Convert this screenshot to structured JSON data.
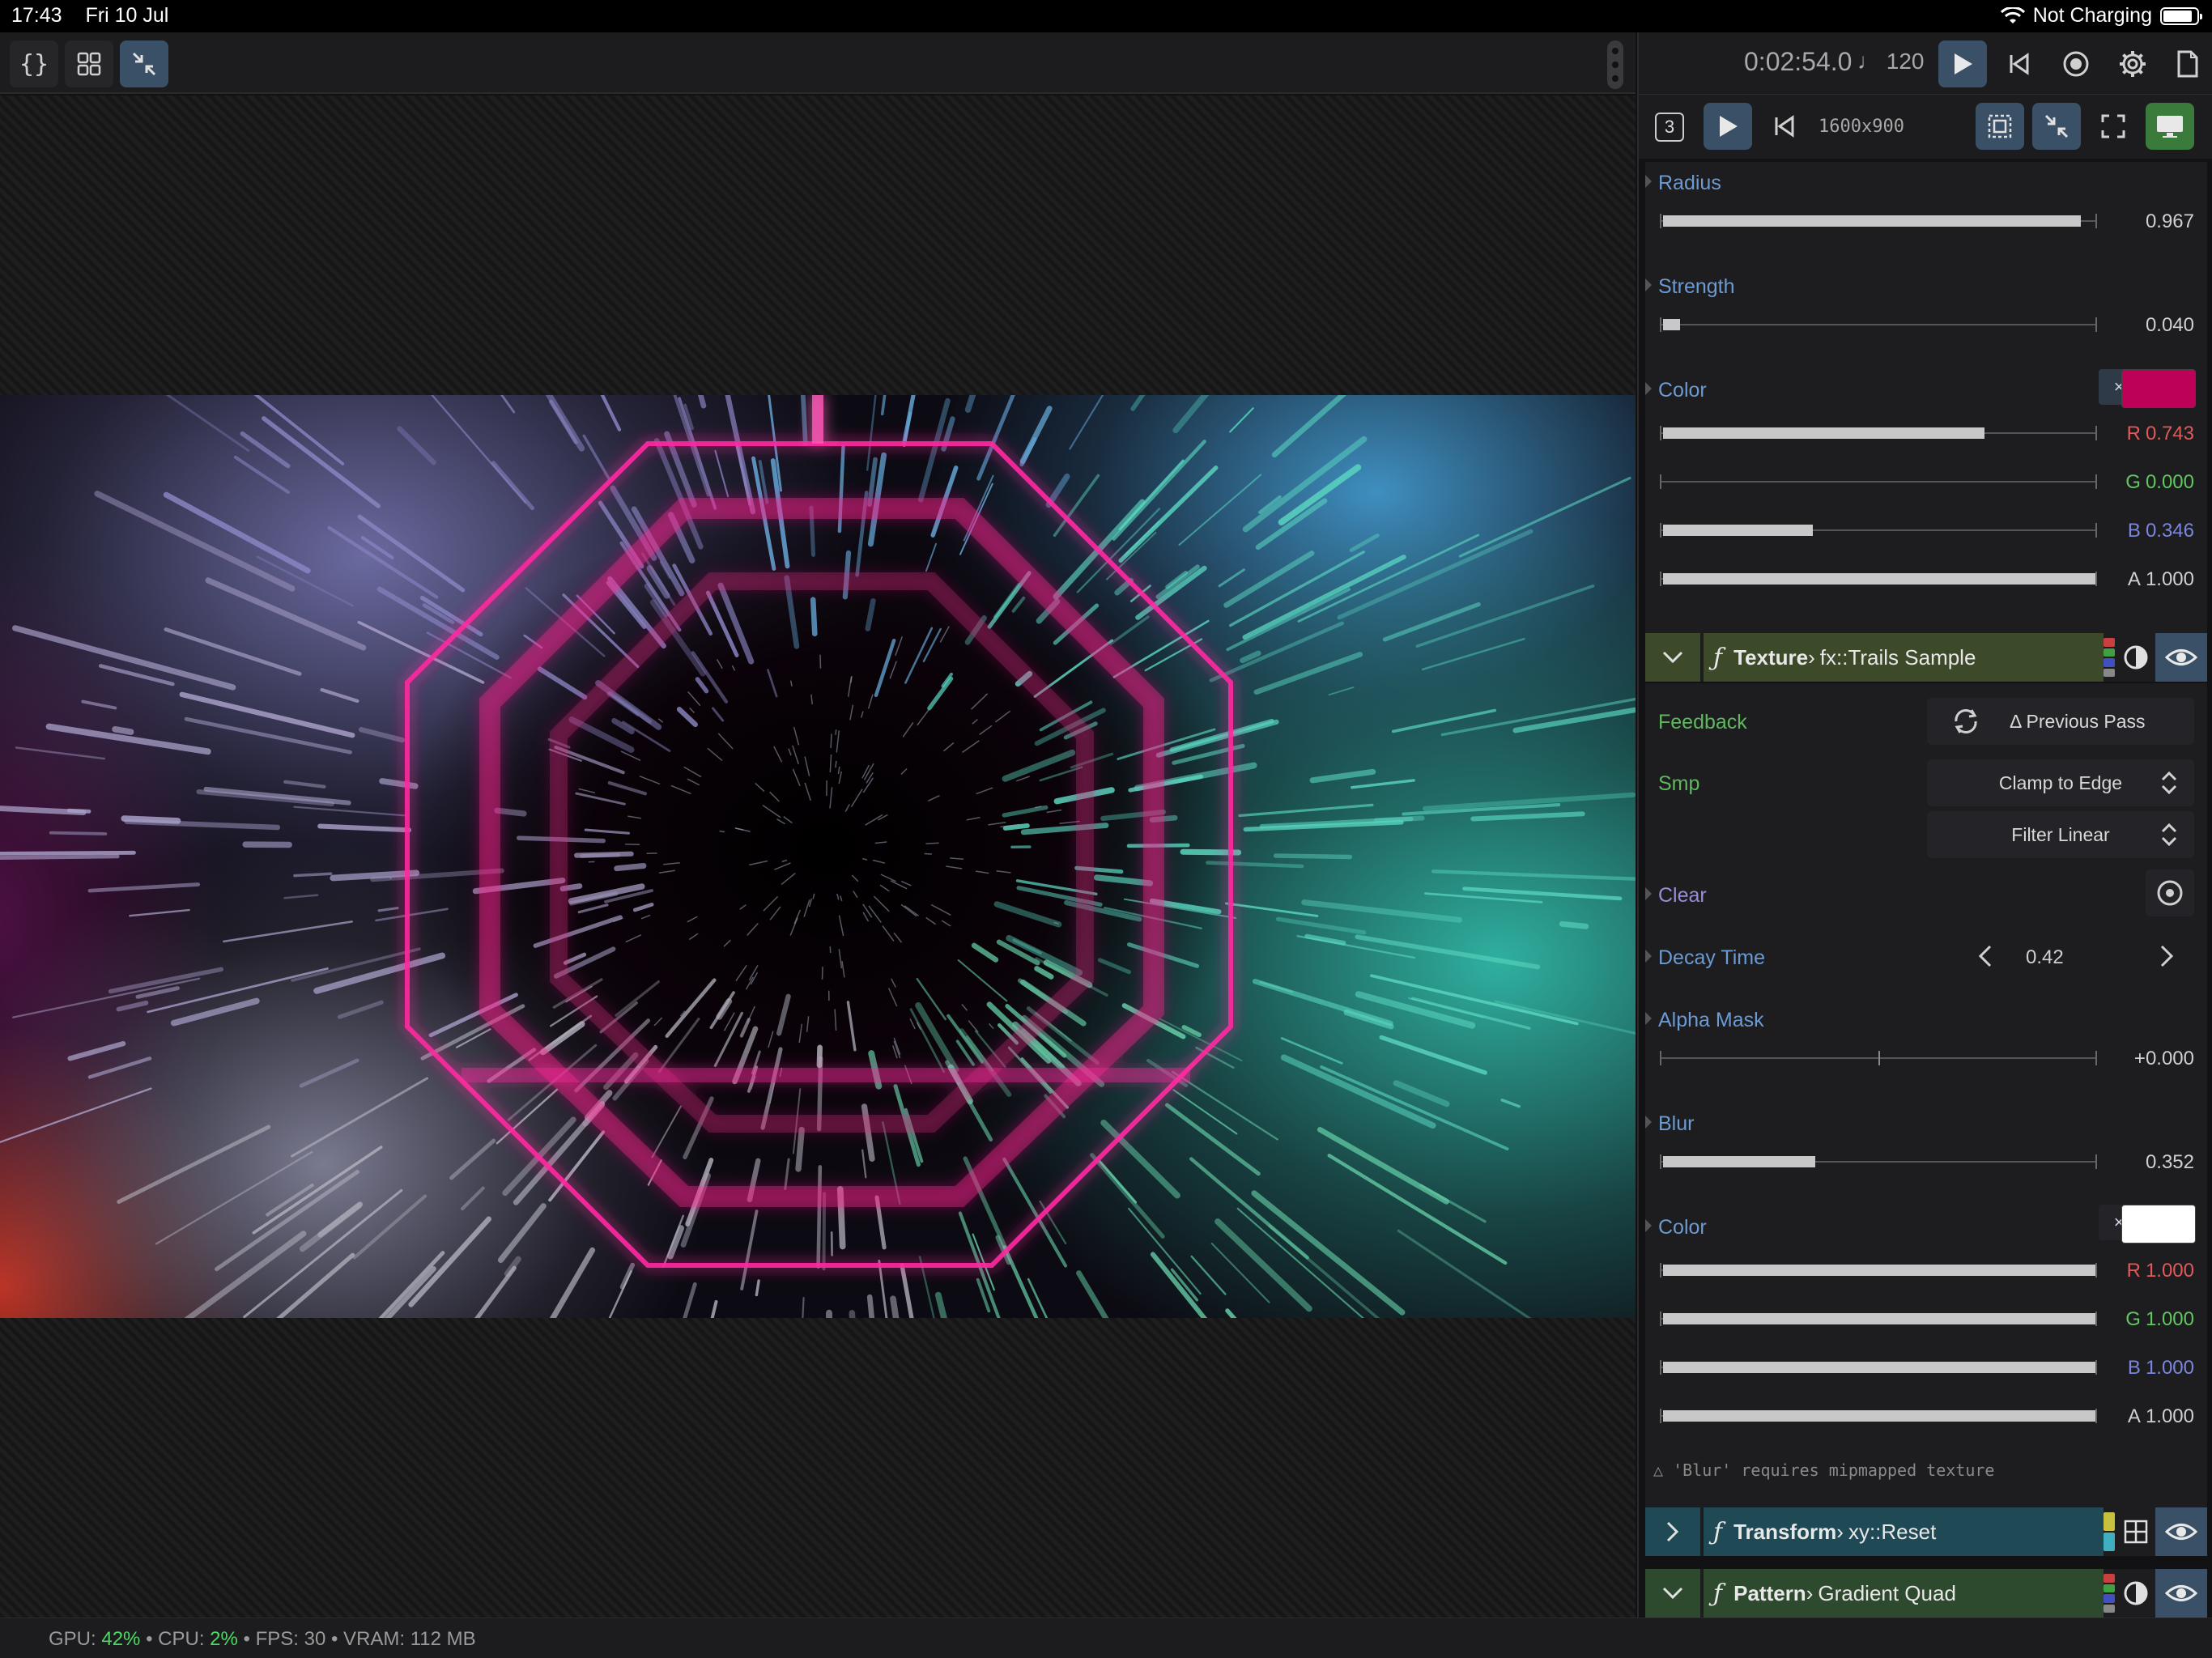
{
  "status_bar": {
    "time": "17:43",
    "date": "Fri 10 Jul",
    "charging": "Not Charging"
  },
  "left_toolbar": {
    "code_icon": "{}",
    "grid_icon": "grid-icon",
    "collapse_icon": "collapse-icon"
  },
  "transport": {
    "time": "0:02:54.0",
    "bpm": "♩ 120"
  },
  "view_bar": {
    "output_index": "3",
    "resolution": "1600x900"
  },
  "params_top": {
    "radius": {
      "label": "Radius",
      "value": "0.967",
      "fraction": 0.967
    },
    "strength": {
      "label": "Strength",
      "value": "0.040",
      "fraction": 0.04
    },
    "color": {
      "label": "Color",
      "xa_label": "× A",
      "swatch": "#bd0058",
      "r": {
        "label": "R",
        "value": "0.743",
        "fraction": 0.743
      },
      "g": {
        "label": "G",
        "value": "0.000",
        "fraction": 0.0
      },
      "b": {
        "label": "B",
        "value": "0.346",
        "fraction": 0.346
      },
      "a": {
        "label": "A",
        "value": "1.000",
        "fraction": 1.0
      }
    }
  },
  "texture_node": {
    "kind": "Texture",
    "sep": "›",
    "name": "fx::Trails Sample",
    "feedback_label": "Feedback",
    "feedback_value": "Δ Previous Pass",
    "smp_label": "Smp",
    "smp_wrap": "Clamp to Edge",
    "smp_filter": "Filter Linear",
    "clear_label": "Clear",
    "decay_label": "Decay Time",
    "decay_value": "0.42",
    "alpha_mask": {
      "label": "Alpha Mask",
      "value": "+0.000",
      "fraction": 0.5
    },
    "blur": {
      "label": "Blur",
      "value": "0.352",
      "fraction": 0.352
    },
    "color": {
      "label": "Color",
      "xa_label": "× A",
      "swatch": "#ffffff",
      "r": {
        "label": "R",
        "value": "1.000",
        "fraction": 1.0
      },
      "g": {
        "label": "G",
        "value": "1.000",
        "fraction": 1.0
      },
      "b": {
        "label": "B",
        "value": "1.000",
        "fraction": 1.0
      },
      "a": {
        "label": "A",
        "value": "1.000",
        "fraction": 1.0
      }
    },
    "warning": "△ 'Blur' requires mipmapped texture"
  },
  "transform_node": {
    "kind": "Transform",
    "sep": "›",
    "name": "xy::Reset"
  },
  "pattern_node": {
    "kind": "Pattern",
    "sep": "›",
    "name": "Gradient Quad"
  },
  "footer": {
    "gpu_label": "GPU:",
    "gpu_value": "42%",
    "cpu_label": "• CPU:",
    "cpu_value": "2%",
    "fps": "• FPS: 30",
    "vram": "• VRAM: 112 MB"
  },
  "colors": {
    "accent_blue": "#3a5066",
    "texture_header": "#3d4a2a",
    "transform_header": "#1f4a55",
    "pattern_header": "#2e4a2e",
    "neon_pink": "#ff2aa0"
  }
}
